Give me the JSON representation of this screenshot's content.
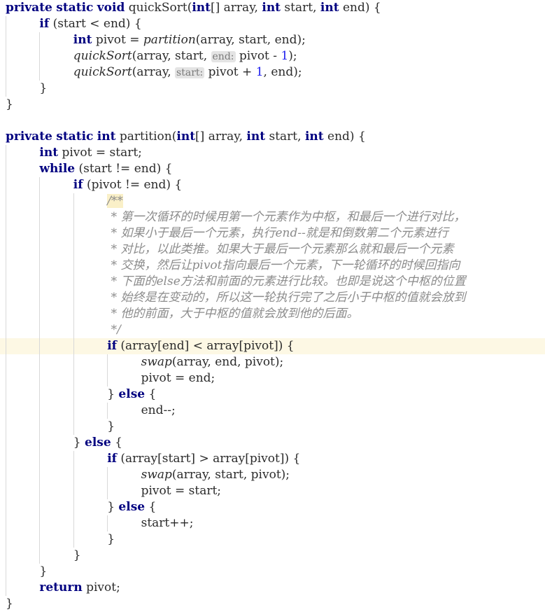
{
  "editor": {
    "language": "java",
    "font_family_kind": "serif-monospace",
    "colors": {
      "background": "#ffffff",
      "foreground": "#2b2b2b",
      "keyword": "#000080",
      "number": "#2020ee",
      "comment": "#8c8c8c",
      "inlay_hint_bg": "#e4e4e4",
      "inlay_hint_fg": "#7a7a7a",
      "caret_line": "#fdf8e4",
      "search_match": "#faf0c8",
      "indent_guide": "#d8d8d8"
    },
    "caret_line_index": 21,
    "indent_guide_x": [
      8,
      56,
      105,
      153,
      201
    ]
  },
  "code": {
    "lines": [
      {
        "indent": 0,
        "tokens": [
          {
            "t": "private",
            "c": "kw"
          },
          {
            "t": " ",
            "c": "txt"
          },
          {
            "t": "static",
            "c": "kw"
          },
          {
            "t": " ",
            "c": "txt"
          },
          {
            "t": "void",
            "c": "kw"
          },
          {
            "t": " quickSort(",
            "c": "txt"
          },
          {
            "t": "int",
            "c": "kw"
          },
          {
            "t": "[] array, ",
            "c": "txt"
          },
          {
            "t": "int",
            "c": "kw"
          },
          {
            "t": " start, ",
            "c": "txt"
          },
          {
            "t": "int",
            "c": "kw"
          },
          {
            "t": " end) {",
            "c": "txt"
          }
        ]
      },
      {
        "indent": 1,
        "tokens": [
          {
            "t": "if",
            "c": "kw"
          },
          {
            "t": " (start < end) {",
            "c": "txt"
          }
        ]
      },
      {
        "indent": 2,
        "tokens": [
          {
            "t": "int",
            "c": "kw"
          },
          {
            "t": " pivot = ",
            "c": "txt"
          },
          {
            "t": "partition",
            "c": "mth"
          },
          {
            "t": "(array, start, end);",
            "c": "txt"
          }
        ]
      },
      {
        "indent": 2,
        "tokens": [
          {
            "t": "quickSort",
            "c": "mth"
          },
          {
            "t": "(array, start, ",
            "c": "txt"
          },
          {
            "t": "end:",
            "c": "hint"
          },
          {
            "t": " pivot - ",
            "c": "txt"
          },
          {
            "t": "1",
            "c": "num"
          },
          {
            "t": ");",
            "c": "txt"
          }
        ]
      },
      {
        "indent": 2,
        "tokens": [
          {
            "t": "quickSort",
            "c": "mth"
          },
          {
            "t": "(array, ",
            "c": "txt"
          },
          {
            "t": "start:",
            "c": "hint"
          },
          {
            "t": " pivot + ",
            "c": "txt"
          },
          {
            "t": "1",
            "c": "num"
          },
          {
            "t": ", end);",
            "c": "txt"
          }
        ]
      },
      {
        "indent": 1,
        "tokens": [
          {
            "t": "}",
            "c": "txt"
          }
        ]
      },
      {
        "indent": 0,
        "tokens": [
          {
            "t": "}",
            "c": "txt"
          }
        ]
      },
      {
        "indent": 0,
        "tokens": []
      },
      {
        "indent": 0,
        "tokens": [
          {
            "t": "private",
            "c": "kw"
          },
          {
            "t": " ",
            "c": "txt"
          },
          {
            "t": "static",
            "c": "kw"
          },
          {
            "t": " ",
            "c": "txt"
          },
          {
            "t": "int",
            "c": "kw"
          },
          {
            "t": " partition(",
            "c": "txt"
          },
          {
            "t": "int",
            "c": "kw"
          },
          {
            "t": "[] array, ",
            "c": "txt"
          },
          {
            "t": "int",
            "c": "kw"
          },
          {
            "t": " start, ",
            "c": "txt"
          },
          {
            "t": "int",
            "c": "kw"
          },
          {
            "t": " end) {",
            "c": "txt"
          }
        ]
      },
      {
        "indent": 1,
        "tokens": [
          {
            "t": "int",
            "c": "kw"
          },
          {
            "t": " pivot = start;",
            "c": "txt"
          }
        ]
      },
      {
        "indent": 1,
        "tokens": [
          {
            "t": "while",
            "c": "kw"
          },
          {
            "t": " (start != end) {",
            "c": "txt"
          }
        ]
      },
      {
        "indent": 2,
        "tokens": [
          {
            "t": "if",
            "c": "kw"
          },
          {
            "t": " (pivot != end) {",
            "c": "txt"
          }
        ]
      },
      {
        "indent": 3,
        "tokens": [
          {
            "t": "/**",
            "c": "cmt mark"
          }
        ]
      },
      {
        "indent": 3,
        "tokens": [
          {
            "t": " * 第一次循环的时候用第一个元素作为中枢，和最后一个进行对比，",
            "c": "cmt"
          }
        ]
      },
      {
        "indent": 3,
        "tokens": [
          {
            "t": " * 如果小于最后一个元素，执行end--就是和倒数第二个元素进行",
            "c": "cmt"
          }
        ]
      },
      {
        "indent": 3,
        "tokens": [
          {
            "t": " * 对比，以此类推。如果大于最后一个元素那么就和最后一个元素",
            "c": "cmt"
          }
        ]
      },
      {
        "indent": 3,
        "tokens": [
          {
            "t": " * 交换，然后让pivot指向最后一个元素，下一轮循环的时候回指向",
            "c": "cmt"
          }
        ]
      },
      {
        "indent": 3,
        "tokens": [
          {
            "t": " * 下面的else方法和前面的元素进行比较。也即是说这个中枢的位置",
            "c": "cmt"
          }
        ]
      },
      {
        "indent": 3,
        "tokens": [
          {
            "t": " * 始终是在变动的，所以这一轮执行完了之后小于中枢的值就会放到",
            "c": "cmt"
          }
        ]
      },
      {
        "indent": 3,
        "tokens": [
          {
            "t": " * 他的前面，大于中枢的值就会放到他的后面。",
            "c": "cmt"
          }
        ]
      },
      {
        "indent": 3,
        "tokens": [
          {
            "t": " */",
            "c": "cmt"
          }
        ]
      },
      {
        "indent": 3,
        "tokens": [
          {
            "t": "if",
            "c": "kw"
          },
          {
            "t": " (array[end] < array[pivot]) {",
            "c": "txt"
          }
        ]
      },
      {
        "indent": 4,
        "tokens": [
          {
            "t": "swap",
            "c": "mth"
          },
          {
            "t": "(array, end, pivot);",
            "c": "txt"
          }
        ]
      },
      {
        "indent": 4,
        "tokens": [
          {
            "t": "pivot = end;",
            "c": "txt"
          }
        ]
      },
      {
        "indent": 3,
        "tokens": [
          {
            "t": "} ",
            "c": "txt"
          },
          {
            "t": "else",
            "c": "kw"
          },
          {
            "t": " {",
            "c": "txt"
          }
        ]
      },
      {
        "indent": 4,
        "tokens": [
          {
            "t": "end--;",
            "c": "txt"
          }
        ]
      },
      {
        "indent": 3,
        "tokens": [
          {
            "t": "}",
            "c": "txt"
          }
        ]
      },
      {
        "indent": 2,
        "tokens": [
          {
            "t": "} ",
            "c": "txt"
          },
          {
            "t": "else",
            "c": "kw"
          },
          {
            "t": " {",
            "c": "txt"
          }
        ]
      },
      {
        "indent": 3,
        "tokens": [
          {
            "t": "if",
            "c": "kw"
          },
          {
            "t": " (array[start] > array[pivot]) {",
            "c": "txt"
          }
        ]
      },
      {
        "indent": 4,
        "tokens": [
          {
            "t": "swap",
            "c": "mth"
          },
          {
            "t": "(array, start, pivot);",
            "c": "txt"
          }
        ]
      },
      {
        "indent": 4,
        "tokens": [
          {
            "t": "pivot = start;",
            "c": "txt"
          }
        ]
      },
      {
        "indent": 3,
        "tokens": [
          {
            "t": "} ",
            "c": "txt"
          },
          {
            "t": "else",
            "c": "kw"
          },
          {
            "t": " {",
            "c": "txt"
          }
        ]
      },
      {
        "indent": 4,
        "tokens": [
          {
            "t": "start++;",
            "c": "txt"
          }
        ]
      },
      {
        "indent": 3,
        "tokens": [
          {
            "t": "}",
            "c": "txt"
          }
        ]
      },
      {
        "indent": 2,
        "tokens": [
          {
            "t": "}",
            "c": "txt"
          }
        ]
      },
      {
        "indent": 1,
        "tokens": [
          {
            "t": "}",
            "c": "txt"
          }
        ]
      },
      {
        "indent": 1,
        "tokens": [
          {
            "t": "return",
            "c": "kw"
          },
          {
            "t": " pivot;",
            "c": "txt"
          }
        ]
      },
      {
        "indent": 0,
        "tokens": [
          {
            "t": "}",
            "c": "txt"
          }
        ]
      }
    ]
  }
}
